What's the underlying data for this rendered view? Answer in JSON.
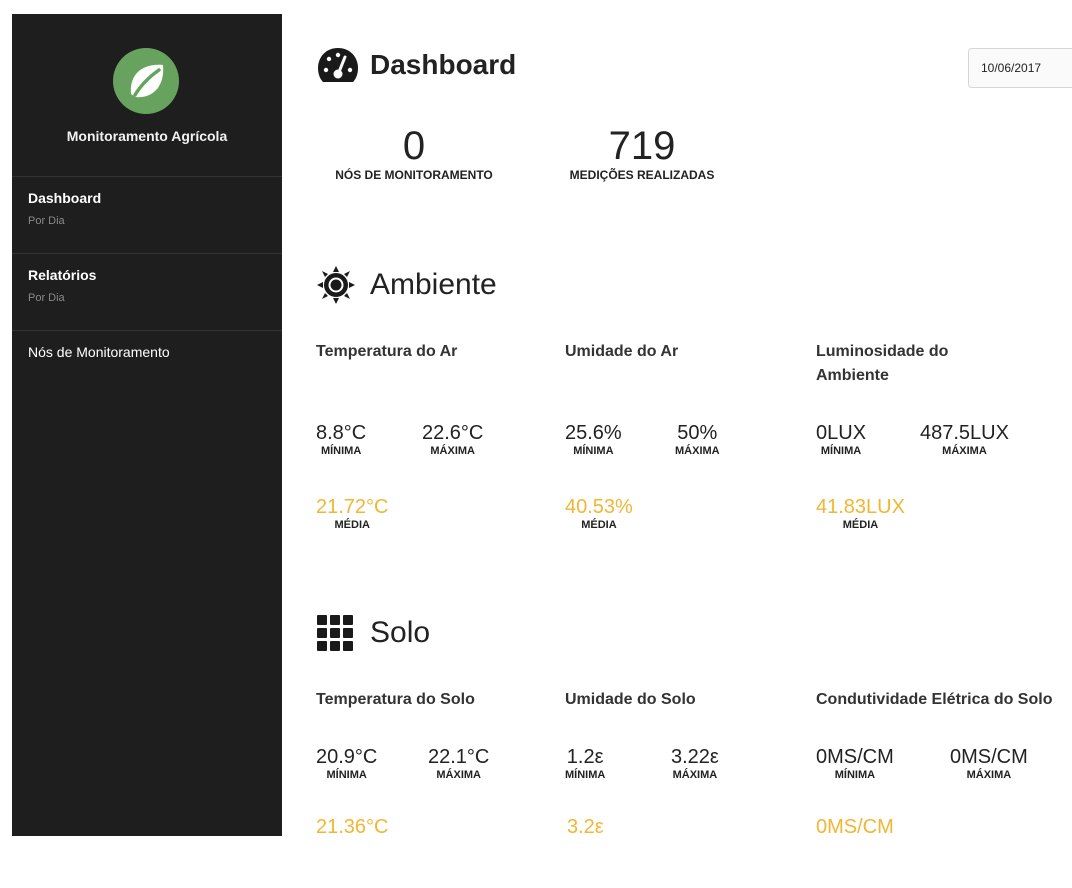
{
  "sidebar": {
    "app_title": "Monitoramento Agrícola",
    "logo_icon": "leaf-icon",
    "items": [
      {
        "label": "Dashboard",
        "sub": "Por Dia"
      },
      {
        "label": "Relatórios",
        "sub": "Por Dia"
      },
      {
        "label": "Nós de Monitoramento"
      }
    ]
  },
  "header": {
    "title": "Dashboard",
    "icon": "speedometer-icon",
    "date": "10/06/2017"
  },
  "stats": [
    {
      "value": "0",
      "label": "NÓS DE MONITORAMENTO"
    },
    {
      "value": "719",
      "label": "MEDIÇÕES REALIZADAS"
    }
  ],
  "ambiente": {
    "title": "Ambiente",
    "icon": "sun-gear-icon",
    "metrics": [
      {
        "title": "Temperatura do Ar",
        "min": "8.8°C",
        "max": "22.6°C",
        "avg": "21.72°C"
      },
      {
        "title": "Umidade do Ar",
        "min": "25.6%",
        "max": "50%",
        "avg": "40.53%"
      },
      {
        "title": "Luminosidade do Ambiente",
        "min": "0LUX",
        "max": "487.5LUX",
        "avg": "41.83LUX"
      }
    ]
  },
  "solo": {
    "title": "Solo",
    "icon": "grid-icon",
    "metrics": [
      {
        "title": "Temperatura do Solo",
        "min": "20.9°C",
        "max": "22.1°C",
        "avg": "21.36°C"
      },
      {
        "title": "Umidade do Solo",
        "min": "1.2ε",
        "max": "3.22ε",
        "avg": "3.2ε"
      },
      {
        "title": "Condutividade Elétrica do Solo",
        "min": "0MS/CM",
        "max": "0MS/CM",
        "avg": "0MS/CM"
      }
    ]
  },
  "labels": {
    "min": "MÍNIMA",
    "max": "MÁXIMA",
    "avg": "MÉDIA"
  },
  "colors": {
    "sidebar_bg": "#1e1e1e",
    "logo_green": "#67a35e",
    "average": "#f2b632"
  }
}
